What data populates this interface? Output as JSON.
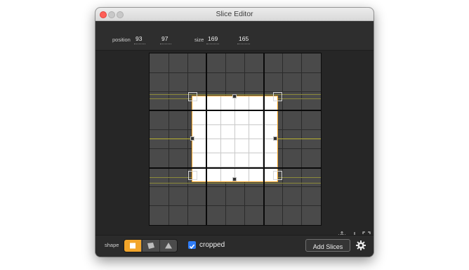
{
  "window": {
    "title": "Slice Editor"
  },
  "info": {
    "position_label": "position",
    "position_x": "93",
    "position_y": "97",
    "size_label": "size",
    "size_w": "169",
    "size_h": "165"
  },
  "canvas_tools": {
    "icons": [
      "move-icon",
      "download-arrow-icon",
      "fit-screen-icon"
    ]
  },
  "footer": {
    "shape_label": "shape",
    "shapes": [
      "square",
      "polygon",
      "triangle"
    ],
    "selected_shape": "square",
    "cropped_label": "cropped",
    "cropped_checked": true,
    "add_slices_label": "Add Slices"
  },
  "colors": {
    "accent": "#f2a52a",
    "checkbox": "#2e7cf6",
    "close": "#fe5f57"
  }
}
